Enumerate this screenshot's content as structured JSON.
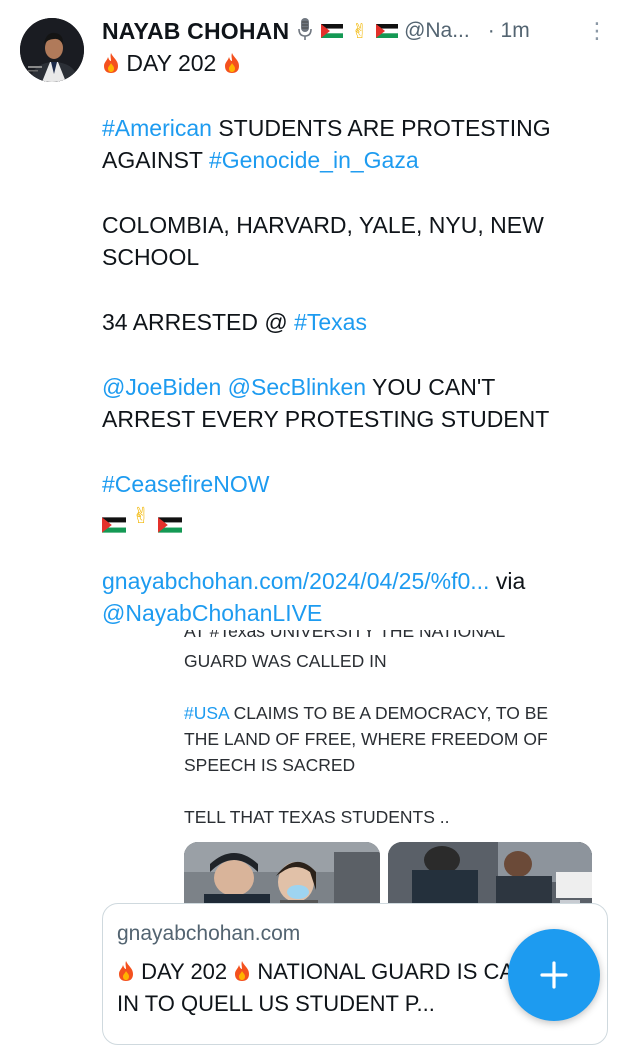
{
  "author": {
    "name": "NAYAB CHOHAN",
    "handle": "@Na...",
    "time": "· 1m",
    "badges": [
      "microphone-icon",
      "palestine-flag-icon",
      "victory-hand-icon",
      "palestine-flag-icon"
    ]
  },
  "post": {
    "line1_text": "DAY 202",
    "p2_tag1": "#American",
    "p2_text1": " STUDENTS ARE PROTESTING AGAINST ",
    "p2_tag2": "#Genocide_in_Gaza",
    "p3": "COLOMBIA, HARVARD, YALE, NYU, NEW SCHOOL",
    "p4_text": "34 ARRESTED @ ",
    "p4_tag": "#Texas",
    "p5_mention1": "@JoeBiden",
    "p5_mention2": "@SecBlinken",
    "p5_text": " YOU CAN'T ARREST EVERY PROTESTING STUDENT",
    "p6_tag": "#CeasefireNOW",
    "link_url": "gnayabchohan.com/2024/04/25/%f0...",
    "link_via": " via",
    "link_mention": "@NayabChohanLIVE"
  },
  "preview": {
    "cut_line_text": "AT #Texas UNIVERSITY THE NATIONAL",
    "line2": "GUARD WAS CALLED IN",
    "p2_tag": "#USA",
    "p2_text": " CLAIMS TO BE A DEMOCRACY, TO BE THE LAND OF FREE, WHERE FREEDOM OF SPEECH IS SACRED",
    "p3": "TELL THAT TEXAS STUDENTS .."
  },
  "link_card": {
    "domain": "gnayabchohan.com",
    "title_part1": "DAY 202",
    "title_part2": "NATIONAL GUARD IS CALLED IN TO QUELL US STUDENT P..."
  },
  "fab": {
    "label": "+"
  },
  "colors": {
    "accent": "#1d9bf0",
    "text": "#0f1419",
    "secondary": "#536471"
  }
}
